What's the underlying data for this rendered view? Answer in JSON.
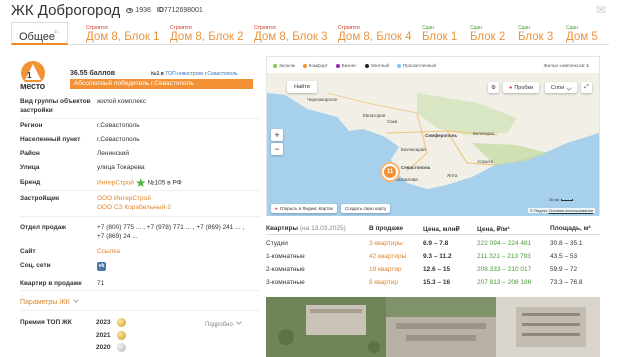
{
  "header": {
    "title": "ЖК Доброгород",
    "views": "1936",
    "id_label": "ID",
    "id_value": "7712698001"
  },
  "tabs": [
    {
      "status": "",
      "label": "Общее",
      "sup": "31"
    },
    {
      "status": "Строится",
      "label": "Дом 8, Блок 1"
    },
    {
      "status": "Строится",
      "label": "Дом 8, Блок 2"
    },
    {
      "status": "Строится",
      "label": "Дом 8, Блок 3"
    },
    {
      "status": "Строится",
      "label": "Дом 8, Блок 4"
    },
    {
      "status": "Сдан",
      "label": "Блок 1"
    },
    {
      "status": "Сдан",
      "label": "Блок 2"
    },
    {
      "status": "Сдан",
      "label": "Блок 3"
    },
    {
      "status": "Сдан",
      "label": "Дом 5"
    }
  ],
  "summary": {
    "rating": "36.55 баллов",
    "top_prefix": "№1 в ",
    "top_link": "ТОП-новостроек г.Севастополь",
    "winner": "Абсолютный победитель г.Севастополь",
    "logo_text": "место"
  },
  "props": {
    "group_label": "Вид группы объектов застройки",
    "group_value": "жилой комплекс",
    "region_label": "Регион",
    "region_value": "г.Севастополь",
    "city_label": "Населенный пункт",
    "city_value": "г.Севастополь",
    "district_label": "Район",
    "district_value": "Ленинский",
    "street_label": "Улица",
    "street_value": "улица Токарева",
    "brand_label": "Бренд",
    "brand_value": "ИнтерСтрой",
    "brand_rank": "№105 в РФ",
    "developer_label": "Застройщик",
    "developer_1": "ООО ИнтерСтрой",
    "developer_2": "ООО СЗ Корабельный-2",
    "sales_label": "Отдел продаж",
    "sales_line1": "+7 (800) 775 ... , +7 (978) 771 ... , +7 (869) 241 ... ,",
    "sales_line2": "+7 (869) 24 ...",
    "site_label": "Сайт",
    "site_value": "Ссылка",
    "social_label": "Соц. сети",
    "social_icon": "vk-icon",
    "on_sale_label": "Квартир в продаже",
    "on_sale_value": "71",
    "params_link": "Параметры ЖК",
    "premium_label": "Премия ТОП ЖК",
    "premium_years": [
      "2023",
      "2021",
      "2020"
    ],
    "detail_link": "Подробно"
  },
  "map": {
    "legend": [
      {
        "label": "Эконом",
        "color": "#8bc34a"
      },
      {
        "label": "Комфорт",
        "color": "#f39234"
      },
      {
        "label": "Бизнес",
        "color": "#9c27b0"
      },
      {
        "label": "Элитный",
        "color": "#212121"
      },
      {
        "label": "Просветленный",
        "color": "#7ac7f0"
      }
    ],
    "complexes_label": "Жилых комплексов:",
    "complexes_count": "1",
    "find_button": "Найти",
    "traffic_button": "Пробки",
    "layers_button": "Слои",
    "cluster_count": "11",
    "labels": [
      "Черноморское",
      "Саки",
      "Евпатория",
      "Симферополь",
      "Белогорск",
      "Бахчисарай",
      "Ялта",
      "Алушта",
      "Балаклава",
      "Севастополь"
    ],
    "open_link": "Открыть в Яндекс Картах",
    "create_link": "Создать свою карту",
    "scale": "30 км",
    "copyright": "© Яндекс",
    "terms_link": "Условия использования"
  },
  "table": {
    "col_flats": "Квартиры",
    "col_flats_date": "(на 13.03.2025)",
    "col_sale": "В продаже",
    "col_price": "Цена, млн₽",
    "col_pm2": "Цена, ₽/м²",
    "col_area": "Площадь, м²",
    "rows": [
      {
        "flat": "Студии",
        "sale": "3 квартиры",
        "price": "6.9 – 7.8",
        "pm2": "222 094 – 224 481",
        "area": "30.8 – 35.1"
      },
      {
        "flat": "1-комнатные",
        "sale": "42 квартиры",
        "price": "9.3 – 11.2",
        "pm2": "211 321 – 213 793",
        "area": "43.5 – 53"
      },
      {
        "flat": "2-комнатные",
        "sale": "18 квартир",
        "price": "12.6 – 15",
        "pm2": "208 333 – 210 017",
        "area": "59.9 – 72"
      },
      {
        "flat": "3-комнатные",
        "sale": "8 квартир",
        "price": "15.3 – 16",
        "pm2": "207 813 – 208 186",
        "area": "73.3 – 76.8"
      }
    ]
  }
}
